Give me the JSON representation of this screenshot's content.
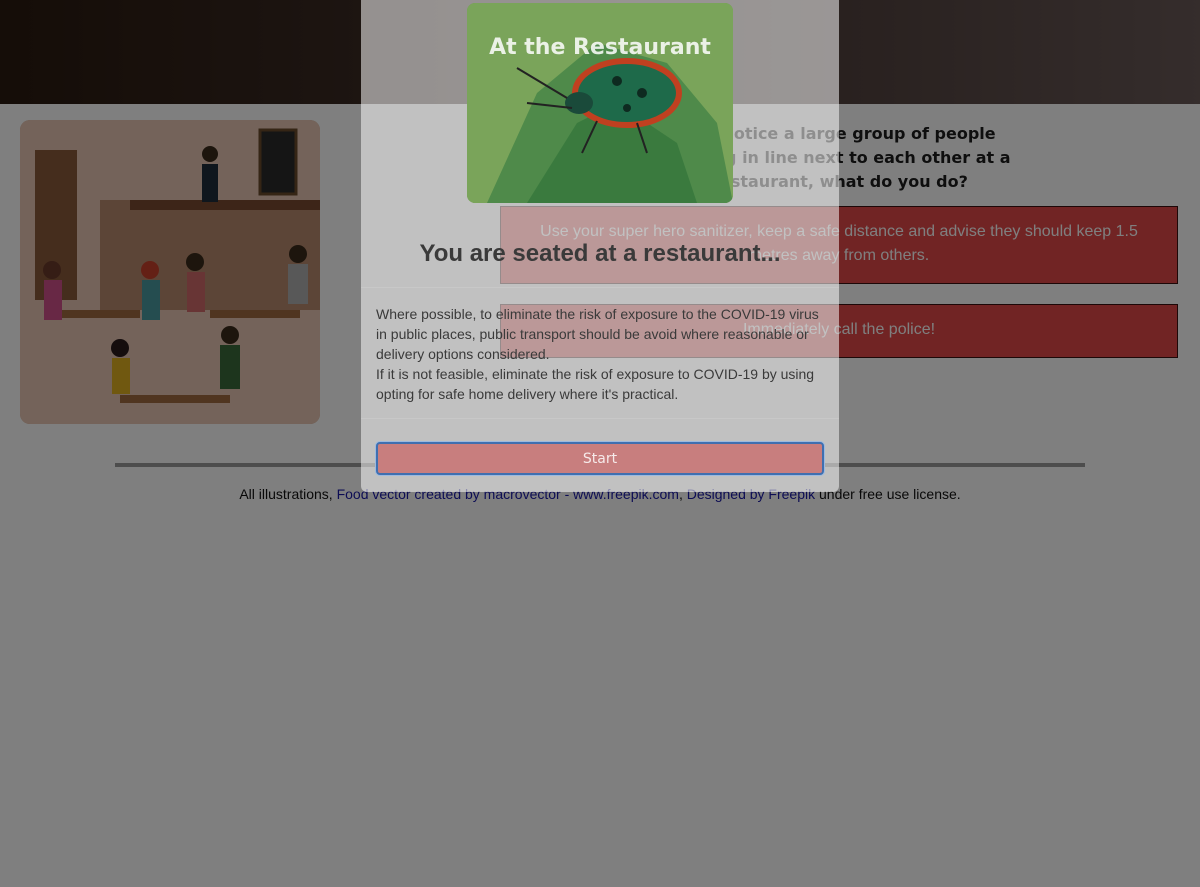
{
  "header": {
    "title": "At the Restaurant"
  },
  "main": {
    "illustration_icon": "restaurant-scene-illustration",
    "question": "You notice a large group of people waiting in line next to each other at a restaurant, what do you do?",
    "answers": [
      {
        "label": "Use your super hero sanitizer, keep a safe distance and advise they should keep 1.5 metres away from others."
      },
      {
        "label": "Immediately call the police!"
      }
    ]
  },
  "footer": {
    "prefix": "All illustrations, ",
    "link1": "Food vector created by macrovector - www.freepik.com",
    "separator": ", ",
    "link2": "Designed by Freepik",
    "suffix": " under free use license."
  },
  "modal": {
    "image_icon": "beetle-on-leaf-photo",
    "image_title": "At the Restaurant",
    "title": "You are seated at a restaurant...",
    "paragraphs": [
      "Where possible, to eliminate the risk of exposure to the COVID-19 virus in public places, public transport should be avoid where reasonable or delivery options considered.",
      "If it is not feasible, eliminate the risk of exposure to COVID-19 by using opting for safe home delivery where it's practical."
    ],
    "start_label": "Start"
  },
  "colors": {
    "answer_background": "#e34848",
    "start_button": "#c87e7e",
    "overlay": "rgba(0,0,0,0.5)"
  }
}
